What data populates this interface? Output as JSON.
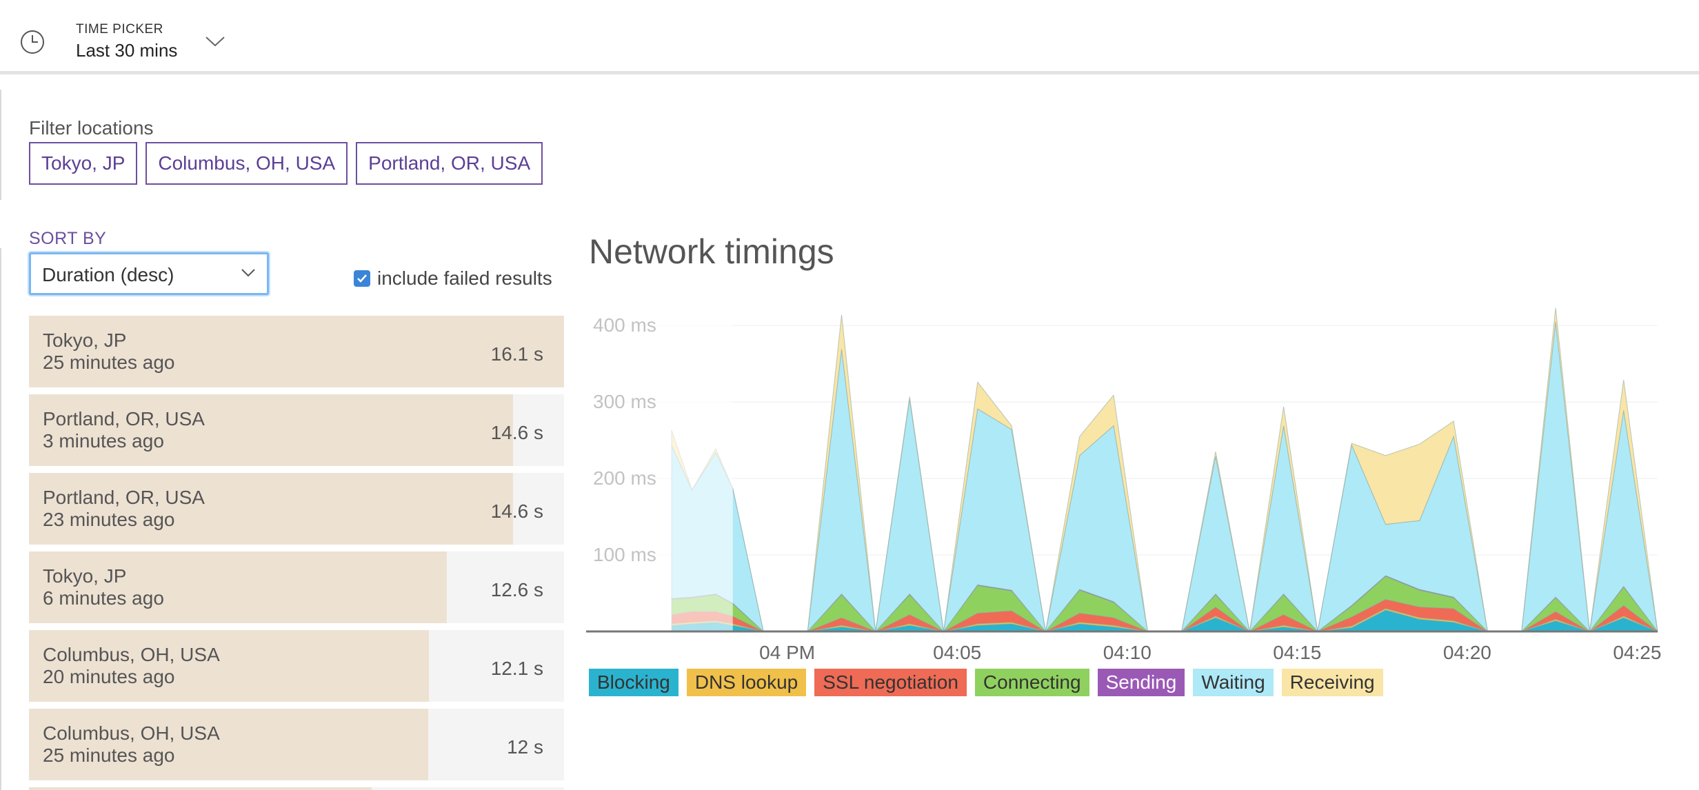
{
  "time_picker": {
    "label": "TIME PICKER",
    "value": "Last 30 mins"
  },
  "filter": {
    "label": "Filter locations",
    "chips": [
      "Tokyo, JP",
      "Columbus, OH, USA",
      "Portland, OR, USA"
    ]
  },
  "sort": {
    "label": "SORT BY",
    "selected": "Duration (desc)",
    "include_failed_label": "include failed results",
    "include_failed_checked": true
  },
  "results": [
    {
      "location": "Tokyo, JP",
      "ago": "25 minutes ago",
      "duration": "16.1 s",
      "fraction": 1.0
    },
    {
      "location": "Portland, OR, USA",
      "ago": "3 minutes ago",
      "duration": "14.6 s",
      "fraction": 0.905
    },
    {
      "location": "Portland, OR, USA",
      "ago": "23 minutes ago",
      "duration": "14.6 s",
      "fraction": 0.905
    },
    {
      "location": "Tokyo, JP",
      "ago": "6 minutes ago",
      "duration": "12.6 s",
      "fraction": 0.781
    },
    {
      "location": "Columbus, OH, USA",
      "ago": "20 minutes ago",
      "duration": "12.1 s",
      "fraction": 0.748
    },
    {
      "location": "Columbus, OH, USA",
      "ago": "25 minutes ago",
      "duration": "12 s",
      "fraction": 0.746
    }
  ],
  "chart_data": {
    "type": "area",
    "title": "Network timings",
    "stacked": true,
    "y_ticks": [
      "100 ms",
      "200 ms",
      "300 ms",
      "400 ms"
    ],
    "ylim": [
      0,
      420
    ],
    "x_ticks": [
      "04 PM",
      "04:05",
      "04:10",
      "04:15",
      "04:20",
      "04:25"
    ],
    "xlim": [
      -3.4,
      25.6
    ],
    "grid": true,
    "legend_position": "bottom",
    "x": [
      -3.4,
      -2.8,
      -2.1,
      -1.6,
      -0.7,
      0.6,
      1.6,
      2.6,
      3.6,
      4.6,
      5.6,
      6.6,
      7.6,
      8.6,
      9.6,
      10.6,
      11.6,
      12.6,
      13.6,
      14.6,
      15.6,
      16.6,
      17.6,
      18.6,
      19.6,
      20.6,
      21.6,
      22.6,
      23.6,
      24.6,
      25.6
    ],
    "series": [
      {
        "name": "Blocking",
        "color": "#2ab3cf",
        "values": [
          8,
          10,
          12,
          8,
          0,
          0,
          6,
          0,
          8,
          0,
          8,
          10,
          0,
          10,
          6,
          0,
          0,
          18,
          0,
          6,
          0,
          5,
          28,
          16,
          12,
          0,
          0,
          14,
          0,
          18,
          0
        ]
      },
      {
        "name": "DNS lookup",
        "color": "#f0c04a",
        "values": [
          2,
          2,
          2,
          2,
          0,
          0,
          2,
          0,
          2,
          0,
          2,
          2,
          0,
          2,
          2,
          0,
          0,
          2,
          0,
          2,
          0,
          2,
          2,
          2,
          2,
          0,
          0,
          2,
          0,
          2,
          0
        ]
      },
      {
        "name": "SSL negotiation",
        "color": "#ef6b55",
        "values": [
          12,
          14,
          12,
          10,
          0,
          0,
          10,
          0,
          12,
          0,
          14,
          15,
          0,
          12,
          10,
          0,
          0,
          12,
          0,
          14,
          0,
          12,
          12,
          14,
          16,
          0,
          0,
          10,
          0,
          14,
          0
        ]
      },
      {
        "name": "Connecting",
        "color": "#8fd15e",
        "values": [
          20,
          18,
          22,
          16,
          0,
          0,
          30,
          0,
          26,
          0,
          36,
          26,
          0,
          30,
          20,
          0,
          0,
          16,
          0,
          26,
          0,
          14,
          30,
          22,
          14,
          0,
          0,
          18,
          0,
          24,
          0
        ]
      },
      {
        "name": "Sending",
        "color": "#9b59b6",
        "values": [
          1,
          1,
          1,
          1,
          0,
          0,
          1,
          0,
          1,
          0,
          1,
          1,
          0,
          1,
          1,
          0,
          0,
          1,
          0,
          1,
          0,
          1,
          1,
          1,
          1,
          0,
          0,
          1,
          0,
          1,
          0
        ]
      },
      {
        "name": "Waiting",
        "color": "#aee9f7",
        "values": [
          200,
          140,
          185,
          150,
          0,
          0,
          320,
          0,
          255,
          0,
          230,
          210,
          0,
          175,
          230,
          0,
          0,
          180,
          0,
          220,
          0,
          210,
          67,
          90,
          210,
          0,
          0,
          360,
          0,
          230,
          0
        ]
      },
      {
        "name": "Receiving",
        "color": "#f9e5a6",
        "values": [
          20,
          0,
          5,
          0,
          0,
          0,
          45,
          0,
          3,
          0,
          35,
          5,
          0,
          25,
          40,
          0,
          0,
          6,
          0,
          25,
          0,
          2,
          90,
          100,
          20,
          0,
          0,
          18,
          0,
          40,
          0
        ]
      }
    ]
  }
}
